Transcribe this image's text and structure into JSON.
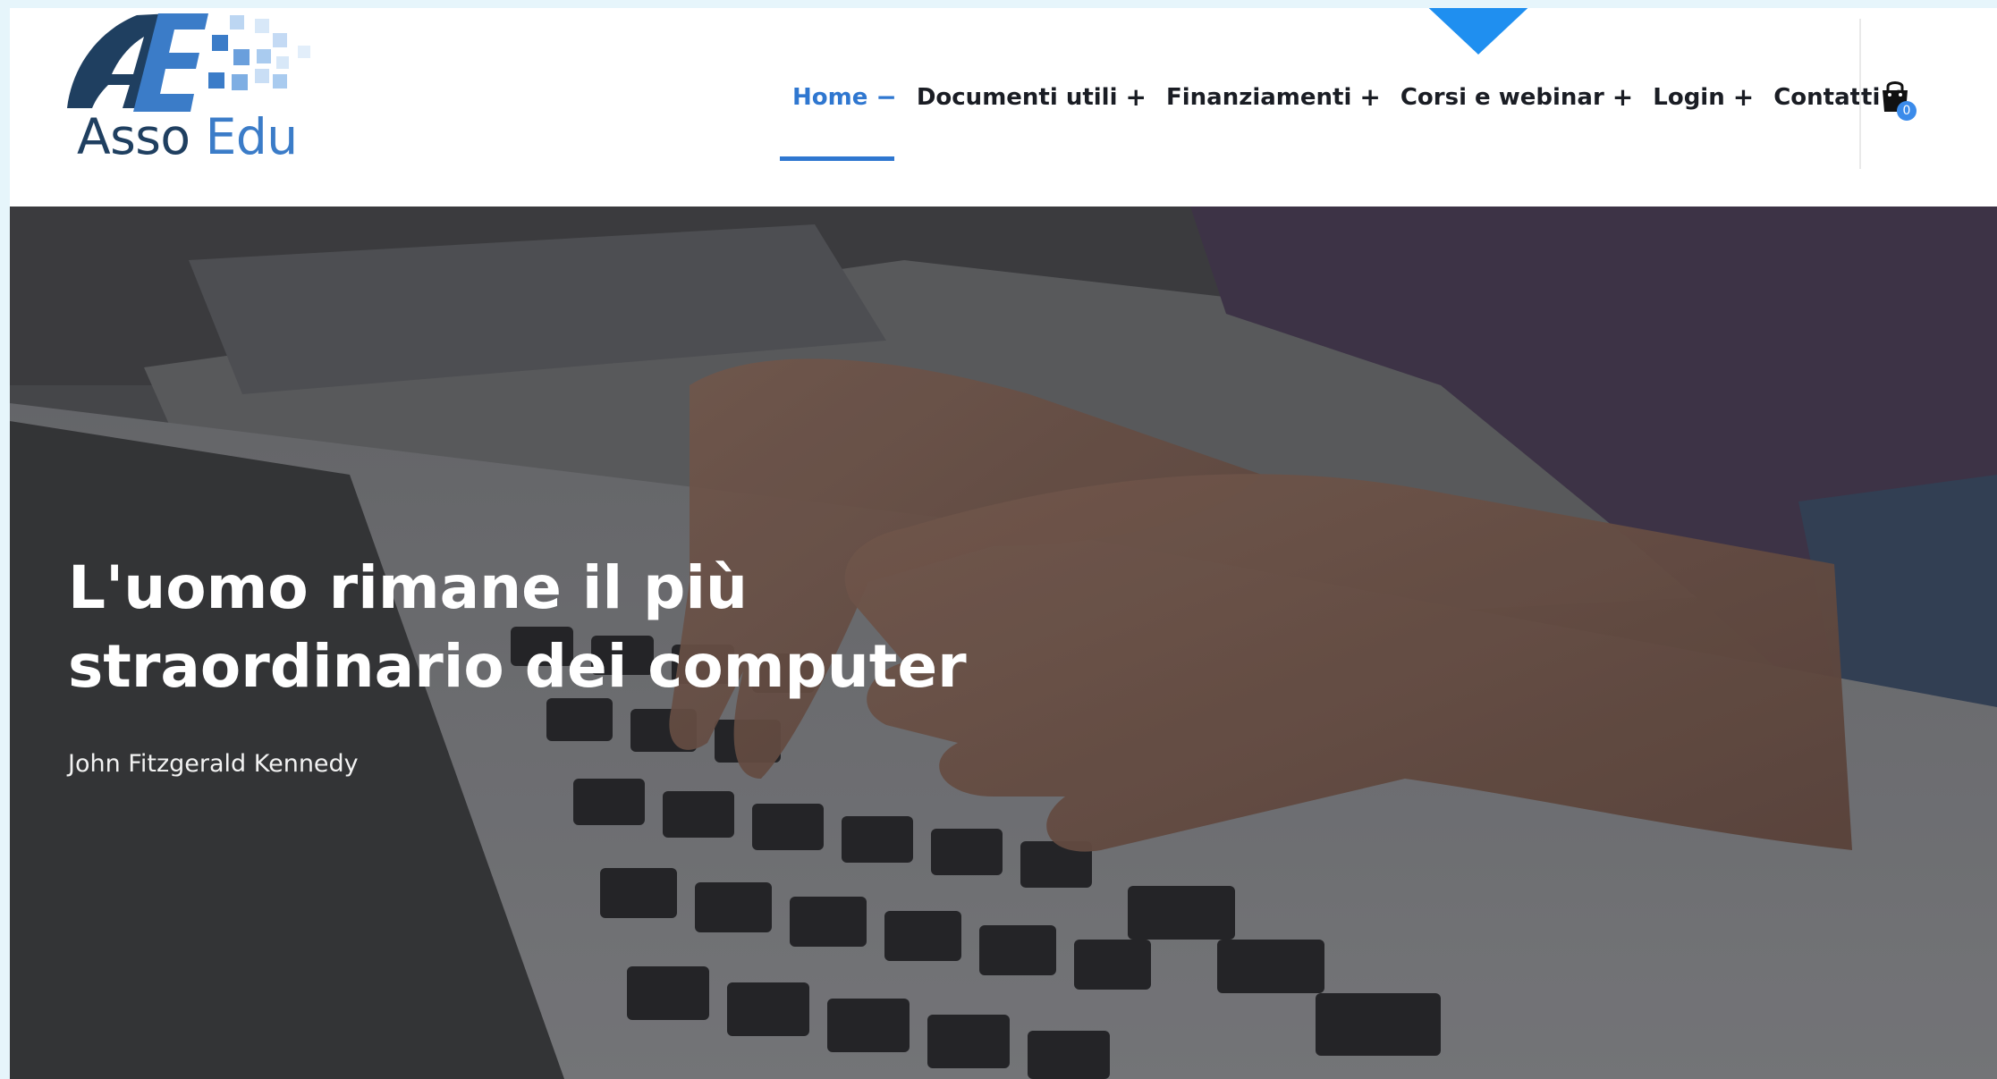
{
  "brand": {
    "name_part1": "Asso",
    "name_part2": "Edu"
  },
  "nav": {
    "items": [
      {
        "label": "Home",
        "sign": "−",
        "active": true
      },
      {
        "label": "Documenti utili",
        "sign": "+",
        "active": false
      },
      {
        "label": "Finanziamenti",
        "sign": "+",
        "active": false
      },
      {
        "label": "Corsi e webinar",
        "sign": "+",
        "active": false
      },
      {
        "label": "Login",
        "sign": "+",
        "active": false
      },
      {
        "label": "Contatti",
        "sign": "+",
        "active": false
      }
    ]
  },
  "cart": {
    "icon": "shopping-bag-icon",
    "count": "0"
  },
  "hero": {
    "quote_line1": "L'uomo rimane il più",
    "quote_line2": "straordinario dei computer",
    "author": "John Fitzgerald Kennedy"
  },
  "colors": {
    "accent": "#2f77d0",
    "indicator": "#1f8ff0",
    "nav_text": "#1a1d24",
    "logo_dark": "#1f3f60",
    "logo_blue": "#3b7cc8",
    "page_tint": "#e6f5fb"
  }
}
